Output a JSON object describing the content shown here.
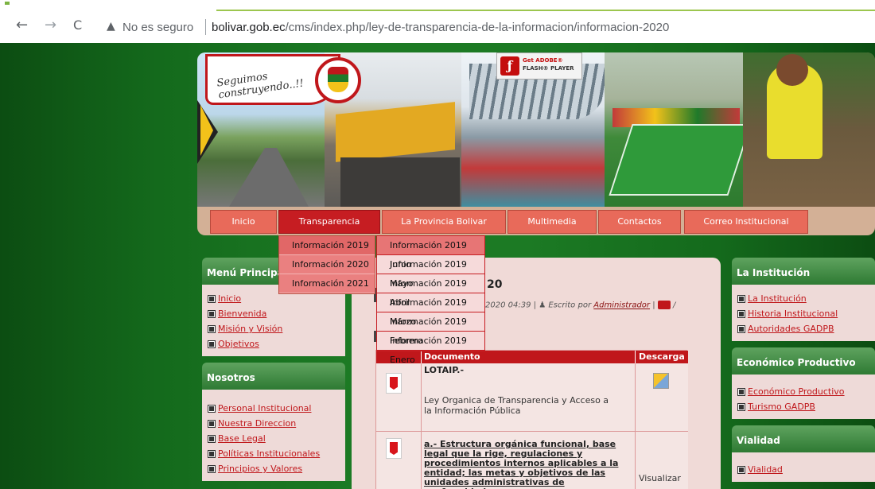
{
  "browser": {
    "back": "←",
    "forward": "→",
    "reload": "C",
    "security_icon": "warning-triangle",
    "security_text": "No es seguro",
    "url_host": "bolivar.gob.ec",
    "url_path": "/cms/index.php/ley-de-transparencia-de-la-informacion/informacion-2020"
  },
  "banner": {
    "slogan": "Seguimos construyendo..!!",
    "flash_line1": "Get ADOBE®",
    "flash_line2": "FLASH® PLAYER"
  },
  "menu": {
    "items": [
      "Inicio",
      "Transparencia",
      "La Provincia Bolivar",
      "Multimedia",
      "Contactos",
      "Correo Institucional"
    ],
    "dropdown": [
      "Información 2019",
      "Información 2020",
      "Información 2021"
    ],
    "submenu": [
      "Información 2019 Junio",
      "Información 2019 Mayo",
      "Información 2019 Abril",
      "Información 2019 Marzo",
      "Información 2019 Febrero",
      "Información 2019 Enero"
    ]
  },
  "left": {
    "menu_title": "Menú Principa",
    "menu_items": [
      "Inicio",
      "Bienvenida",
      "Misión y Visión",
      "Objetivos"
    ],
    "nosotros_title": "Nosotros",
    "nosotros_items": [
      "Personal Institucional",
      "Nuestra Direccion",
      "Base Legal",
      "Políticas Institucionales",
      "Principios y Valores"
    ]
  },
  "right": {
    "inst_title": "La Institución",
    "inst_items": [
      "La Institución",
      "Historia Institucional",
      "Autoridades GADPB"
    ],
    "eco_title": "Económico Productivo",
    "eco_items": [
      "Económico Productivo",
      "Turismo GADPB"
    ],
    "vial_title": "Vialidad",
    "vial_items": [
      "Vialidad"
    ]
  },
  "content": {
    "title_fragment": "20",
    "meta_date": "2020 04:39 |",
    "meta_written": "Escrito por",
    "meta_author": "Administrador",
    "table_headers": [
      "Documento",
      "Descarga"
    ],
    "row1_title": "LOTAIP.-",
    "row1_desc": "Ley Organica de Transparencia y Acceso a la Información Pública",
    "row2_link": "a.- Estructura orgánica funcional, base legal que la rige, regulaciones y procedimientos internos aplicables a la entidad; las metas y objetivos de las unidades administrativas de conformidad con sus programas operativos.-",
    "row2_action": "Visualizar"
  },
  "colors": {
    "green_bg": "#1c7a24",
    "menu_red": "#e86a5a",
    "active_red": "#c61d22",
    "link_red": "#c0171b"
  }
}
